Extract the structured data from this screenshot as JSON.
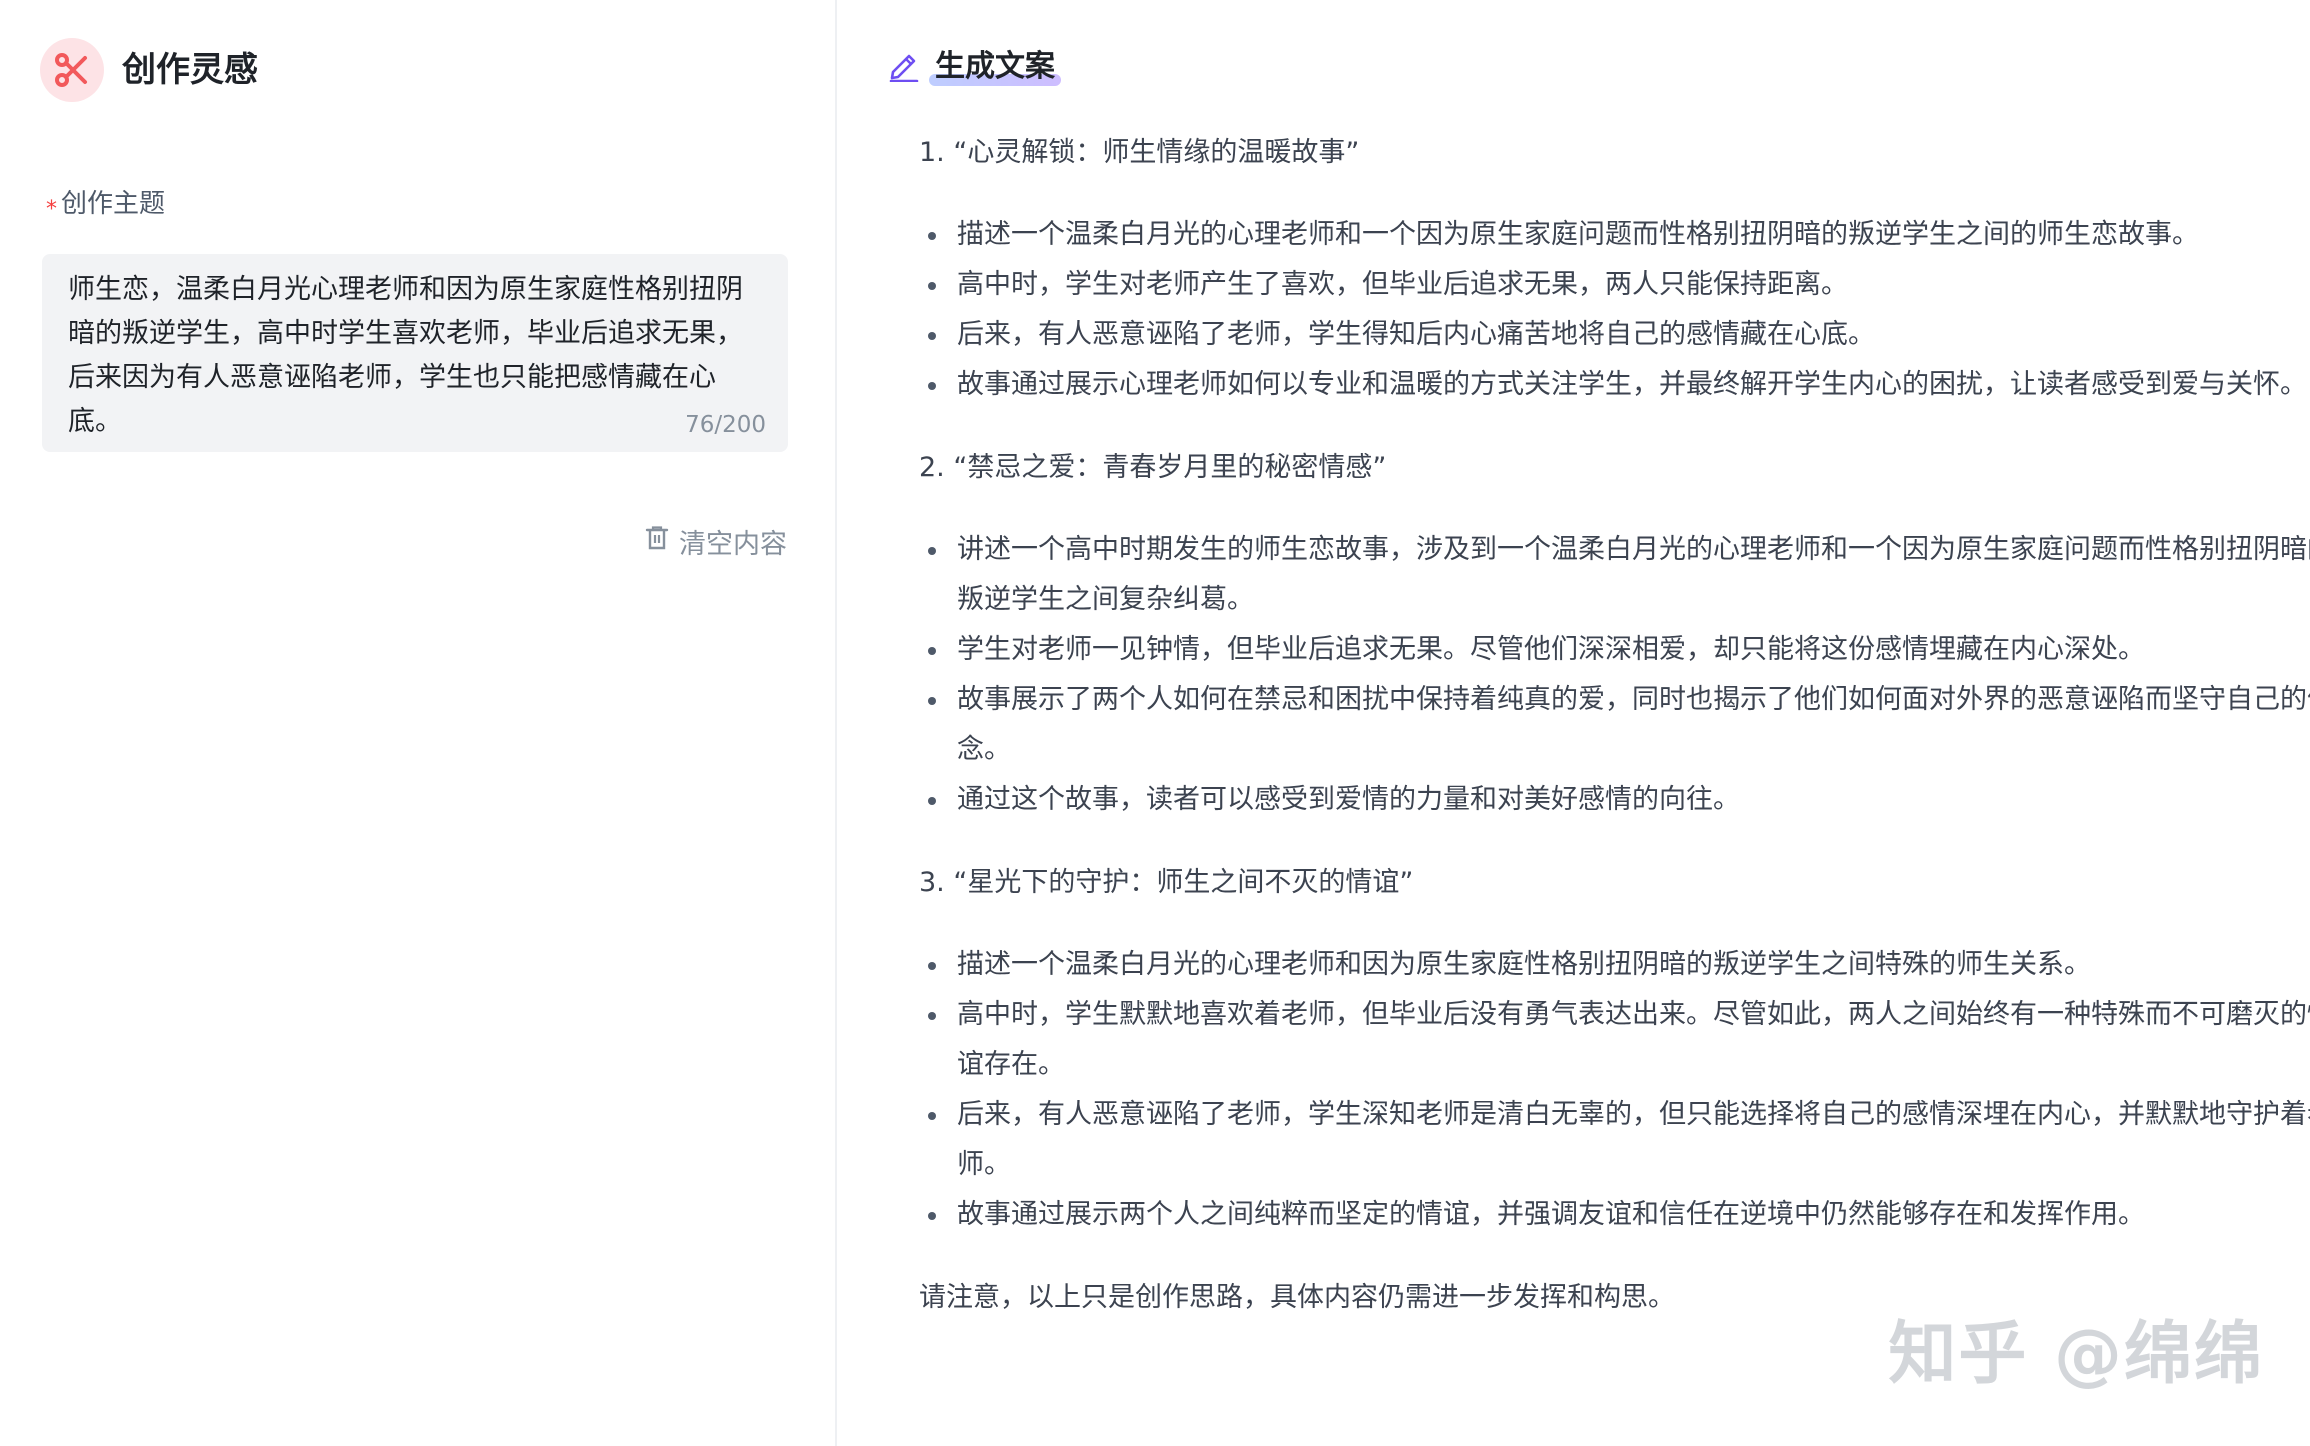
{
  "app": {
    "title": "创作灵感",
    "icon": "scissors-icon",
    "accent": "#f2595b"
  },
  "form": {
    "label": "创作主题",
    "required_mark": "*",
    "value": "师生恋，温柔白月光心理老师和因为原生家庭性格别扭阴暗的叛逆学生，高中时学生喜欢老师，毕业后追求无果，后来因为有人恶意诬陷老师，学生也只能把感情藏在心底。",
    "counter": "76/200",
    "clear_label": "清空内容"
  },
  "result": {
    "title": "生成文案",
    "icon": "pencil-icon",
    "sections": [
      {
        "heading": "1. “心灵解锁：师生情缘的温暖故事”",
        "bullets": [
          "描述一个温柔白月光的心理老师和一个因为原生家庭问题而性格别扭阴暗的叛逆学生之间的师生恋故事。",
          "高中时，学生对老师产生了喜欢，但毕业后追求无果，两人只能保持距离。",
          "后来，有人恶意诬陷了老师，学生得知后内心痛苦地将自己的感情藏在心底。",
          "故事通过展示心理老师如何以专业和温暖的方式关注学生，并最终解开学生内心的困扰，让读者感受到爱与关怀。"
        ]
      },
      {
        "heading": "2. “禁忌之爱：青春岁月里的秘密情感”",
        "bullets": [
          "讲述一个高中时期发生的师生恋故事，涉及到一个温柔白月光的心理老师和一个因为原生家庭问题而性格别扭阴暗的叛逆学生之间复杂纠葛。",
          "学生对老师一见钟情，但毕业后追求无果。尽管他们深深相爱，却只能将这份感情埋藏在内心深处。",
          "故事展示了两个人如何在禁忌和困扰中保持着纯真的爱，同时也揭示了他们如何面对外界的恶意诬陷而坚守自己的信念。",
          "通过这个故事，读者可以感受到爱情的力量和对美好感情的向往。"
        ]
      },
      {
        "heading": "3. “星光下的守护：师生之间不灭的情谊”",
        "bullets": [
          "描述一个温柔白月光的心理老师和因为原生家庭性格别扭阴暗的叛逆学生之间特殊的师生关系。",
          "高中时，学生默默地喜欢着老师，但毕业后没有勇气表达出来。尽管如此，两人之间始终有一种特殊而不可磨灭的情谊存在。",
          "后来，有人恶意诬陷了老师，学生深知老师是清白无辜的，但只能选择将自己的感情深埋在内心，并默默地守护着老师。",
          "故事通过展示两个人之间纯粹而坚定的情谊，并强调友谊和信任在逆境中仍然能够存在和发挥作用。"
        ]
      }
    ],
    "note": "请注意，以上只是创作思路，具体内容仍需进一步发挥和构思。"
  },
  "watermark": "知乎 @绵绵"
}
